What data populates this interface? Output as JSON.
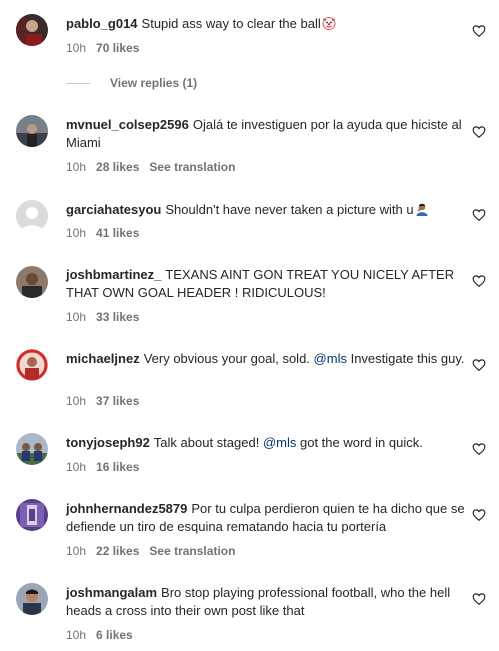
{
  "comments": [
    {
      "username": "pablo_g014",
      "text": "Stupid ass way to clear the ball",
      "emoji": "clown-emoji",
      "time": "10h",
      "likes": "70 likes",
      "view_replies": "View replies (1)",
      "avatar_color": "#8b1a1a"
    },
    {
      "username": "mvnuel_colsep2596",
      "text": "Ojalá te investiguen por la ayuda que hiciste al Miami",
      "time": "10h",
      "likes": "28 likes",
      "translation": "See translation",
      "avatar_color": "#5a5f66"
    },
    {
      "username": "garciahatesyou",
      "text": "Shouldn't have never taken a picture with u",
      "emoji": "person-facepalming-emoji",
      "time": "10h",
      "likes": "41 likes",
      "avatar_color": "#dbdbdb"
    },
    {
      "username": "joshbmartinez_",
      "text": "TEXANS AINT GON TREAT YOU NICELY AFTER THAT OWN GOAL HEADER ! RIDICULOUS!",
      "time": "10h",
      "likes": "33 likes",
      "avatar_color": "#6b5a4a"
    },
    {
      "username": "michaeljnez",
      "text_before": "Very obvious your goal, sold.",
      "mention": "@mls",
      "text_after": "Investigate this guy.",
      "time": "10h",
      "likes": "37 likes",
      "avatar_color": "#b32a2a"
    },
    {
      "username": "tonyjoseph92",
      "text_before": "Talk about staged!",
      "mention": "@mls",
      "text_after": "got the word in quick.",
      "time": "10h",
      "likes": "16 likes",
      "avatar_color": "#7c8a99"
    },
    {
      "username": "johnhernandez5879",
      "text": "Por tu culpa perdieron quien te ha dicho que se defiende un tiro de esquina rematando hacia tu portería",
      "time": "10h",
      "likes": "22 likes",
      "translation": "See translation",
      "avatar_color": "#5b3f8c"
    },
    {
      "username": "joshmangalam",
      "text": "Bro stop playing professional football, who the hell heads a cross into their own post like that",
      "time": "10h",
      "likes": "6 likes",
      "avatar_color": "#3d4a5c"
    }
  ],
  "icons": {
    "like": "heart-outline-icon"
  },
  "colors": {
    "text": "#262626",
    "secondary": "#737373",
    "mention": "#00376b"
  }
}
